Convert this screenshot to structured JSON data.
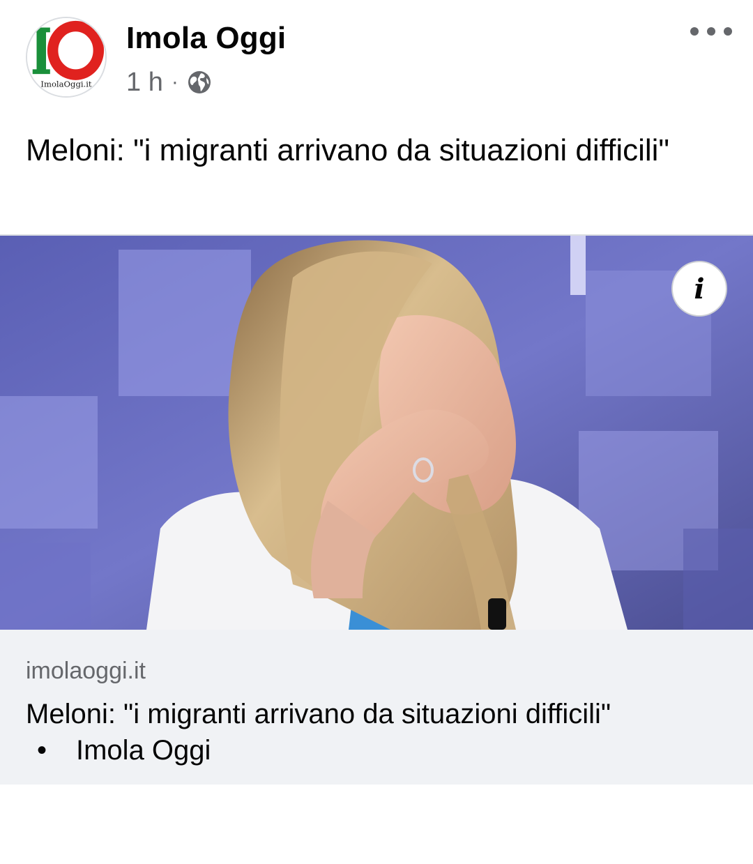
{
  "post": {
    "page_name": "Imola Oggi",
    "avatar_logo_text": "IO",
    "avatar_site_text": "ImolaOggi.it",
    "time": "1 h",
    "separator": "·",
    "audience_icon": "globe-icon",
    "more_icon": "more-options-icon",
    "text": "Meloni: \"i migranti arrivano da situazioni difficili\""
  },
  "link_preview": {
    "info_label": "i",
    "domain": "imolaoggi.it",
    "title": "Meloni: \"i migranti arrivano da situazioni difficili\"",
    "bullet": "•",
    "source": "Imola Oggi"
  },
  "colors": {
    "text_primary": "#050505",
    "text_secondary": "#65676b",
    "footer_bg": "#f0f2f5",
    "logo_green": "#1a8f3a",
    "logo_red": "#e0221f"
  }
}
